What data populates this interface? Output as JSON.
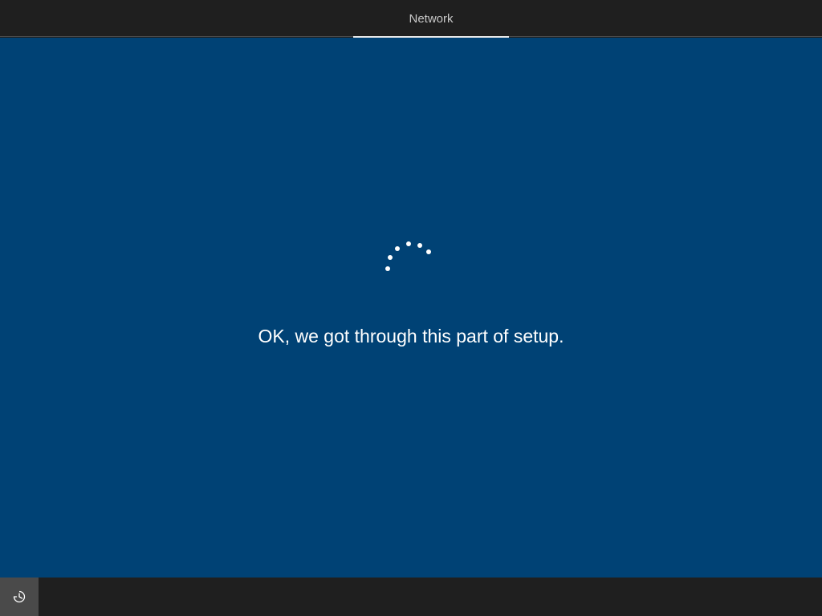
{
  "header": {
    "tabs": [
      {
        "label": "Network",
        "active": true
      }
    ]
  },
  "main": {
    "message": "OK, we got through this part of setup.",
    "spinner": "loading-dots"
  },
  "footer": {
    "ease_of_access_icon": "ease-of-access-icon"
  },
  "colors": {
    "background": "#004275",
    "bars": "#1f1f1f",
    "text": "#ffffff",
    "tab_text": "#c8c8c8"
  }
}
